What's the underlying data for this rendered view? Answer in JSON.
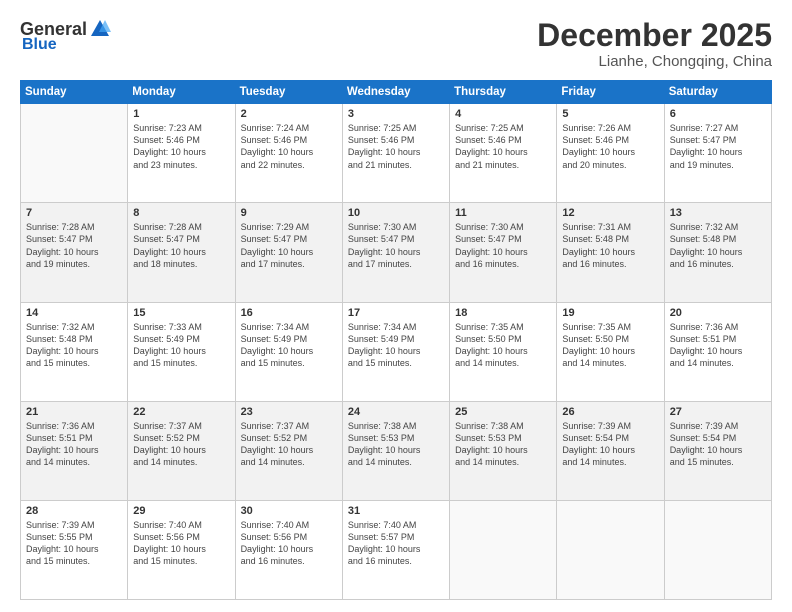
{
  "header": {
    "logo_general": "General",
    "logo_blue": "Blue",
    "month_title": "December 2025",
    "location": "Lianhe, Chongqing, China"
  },
  "days_of_week": [
    "Sunday",
    "Monday",
    "Tuesday",
    "Wednesday",
    "Thursday",
    "Friday",
    "Saturday"
  ],
  "weeks": [
    [
      {
        "day": "",
        "empty": true
      },
      {
        "day": "1",
        "sunrise": "Sunrise: 7:23 AM",
        "sunset": "Sunset: 5:46 PM",
        "daylight": "Daylight: 10 hours and 23 minutes."
      },
      {
        "day": "2",
        "sunrise": "Sunrise: 7:24 AM",
        "sunset": "Sunset: 5:46 PM",
        "daylight": "Daylight: 10 hours and 22 minutes."
      },
      {
        "day": "3",
        "sunrise": "Sunrise: 7:25 AM",
        "sunset": "Sunset: 5:46 PM",
        "daylight": "Daylight: 10 hours and 21 minutes."
      },
      {
        "day": "4",
        "sunrise": "Sunrise: 7:25 AM",
        "sunset": "Sunset: 5:46 PM",
        "daylight": "Daylight: 10 hours and 21 minutes."
      },
      {
        "day": "5",
        "sunrise": "Sunrise: 7:26 AM",
        "sunset": "Sunset: 5:46 PM",
        "daylight": "Daylight: 10 hours and 20 minutes."
      },
      {
        "day": "6",
        "sunrise": "Sunrise: 7:27 AM",
        "sunset": "Sunset: 5:47 PM",
        "daylight": "Daylight: 10 hours and 19 minutes."
      }
    ],
    [
      {
        "day": "7",
        "sunrise": "Sunrise: 7:28 AM",
        "sunset": "Sunset: 5:47 PM",
        "daylight": "Daylight: 10 hours and 19 minutes."
      },
      {
        "day": "8",
        "sunrise": "Sunrise: 7:28 AM",
        "sunset": "Sunset: 5:47 PM",
        "daylight": "Daylight: 10 hours and 18 minutes."
      },
      {
        "day": "9",
        "sunrise": "Sunrise: 7:29 AM",
        "sunset": "Sunset: 5:47 PM",
        "daylight": "Daylight: 10 hours and 17 minutes."
      },
      {
        "day": "10",
        "sunrise": "Sunrise: 7:30 AM",
        "sunset": "Sunset: 5:47 PM",
        "daylight": "Daylight: 10 hours and 17 minutes."
      },
      {
        "day": "11",
        "sunrise": "Sunrise: 7:30 AM",
        "sunset": "Sunset: 5:47 PM",
        "daylight": "Daylight: 10 hours and 16 minutes."
      },
      {
        "day": "12",
        "sunrise": "Sunrise: 7:31 AM",
        "sunset": "Sunset: 5:48 PM",
        "daylight": "Daylight: 10 hours and 16 minutes."
      },
      {
        "day": "13",
        "sunrise": "Sunrise: 7:32 AM",
        "sunset": "Sunset: 5:48 PM",
        "daylight": "Daylight: 10 hours and 16 minutes."
      }
    ],
    [
      {
        "day": "14",
        "sunrise": "Sunrise: 7:32 AM",
        "sunset": "Sunset: 5:48 PM",
        "daylight": "Daylight: 10 hours and 15 minutes."
      },
      {
        "day": "15",
        "sunrise": "Sunrise: 7:33 AM",
        "sunset": "Sunset: 5:49 PM",
        "daylight": "Daylight: 10 hours and 15 minutes."
      },
      {
        "day": "16",
        "sunrise": "Sunrise: 7:34 AM",
        "sunset": "Sunset: 5:49 PM",
        "daylight": "Daylight: 10 hours and 15 minutes."
      },
      {
        "day": "17",
        "sunrise": "Sunrise: 7:34 AM",
        "sunset": "Sunset: 5:49 PM",
        "daylight": "Daylight: 10 hours and 15 minutes."
      },
      {
        "day": "18",
        "sunrise": "Sunrise: 7:35 AM",
        "sunset": "Sunset: 5:50 PM",
        "daylight": "Daylight: 10 hours and 14 minutes."
      },
      {
        "day": "19",
        "sunrise": "Sunrise: 7:35 AM",
        "sunset": "Sunset: 5:50 PM",
        "daylight": "Daylight: 10 hours and 14 minutes."
      },
      {
        "day": "20",
        "sunrise": "Sunrise: 7:36 AM",
        "sunset": "Sunset: 5:51 PM",
        "daylight": "Daylight: 10 hours and 14 minutes."
      }
    ],
    [
      {
        "day": "21",
        "sunrise": "Sunrise: 7:36 AM",
        "sunset": "Sunset: 5:51 PM",
        "daylight": "Daylight: 10 hours and 14 minutes."
      },
      {
        "day": "22",
        "sunrise": "Sunrise: 7:37 AM",
        "sunset": "Sunset: 5:52 PM",
        "daylight": "Daylight: 10 hours and 14 minutes."
      },
      {
        "day": "23",
        "sunrise": "Sunrise: 7:37 AM",
        "sunset": "Sunset: 5:52 PM",
        "daylight": "Daylight: 10 hours and 14 minutes."
      },
      {
        "day": "24",
        "sunrise": "Sunrise: 7:38 AM",
        "sunset": "Sunset: 5:53 PM",
        "daylight": "Daylight: 10 hours and 14 minutes."
      },
      {
        "day": "25",
        "sunrise": "Sunrise: 7:38 AM",
        "sunset": "Sunset: 5:53 PM",
        "daylight": "Daylight: 10 hours and 14 minutes."
      },
      {
        "day": "26",
        "sunrise": "Sunrise: 7:39 AM",
        "sunset": "Sunset: 5:54 PM",
        "daylight": "Daylight: 10 hours and 14 minutes."
      },
      {
        "day": "27",
        "sunrise": "Sunrise: 7:39 AM",
        "sunset": "Sunset: 5:54 PM",
        "daylight": "Daylight: 10 hours and 15 minutes."
      }
    ],
    [
      {
        "day": "28",
        "sunrise": "Sunrise: 7:39 AM",
        "sunset": "Sunset: 5:55 PM",
        "daylight": "Daylight: 10 hours and 15 minutes."
      },
      {
        "day": "29",
        "sunrise": "Sunrise: 7:40 AM",
        "sunset": "Sunset: 5:56 PM",
        "daylight": "Daylight: 10 hours and 15 minutes."
      },
      {
        "day": "30",
        "sunrise": "Sunrise: 7:40 AM",
        "sunset": "Sunset: 5:56 PM",
        "daylight": "Daylight: 10 hours and 16 minutes."
      },
      {
        "day": "31",
        "sunrise": "Sunrise: 7:40 AM",
        "sunset": "Sunset: 5:57 PM",
        "daylight": "Daylight: 10 hours and 16 minutes."
      },
      {
        "day": "",
        "empty": true
      },
      {
        "day": "",
        "empty": true
      },
      {
        "day": "",
        "empty": true
      }
    ]
  ]
}
